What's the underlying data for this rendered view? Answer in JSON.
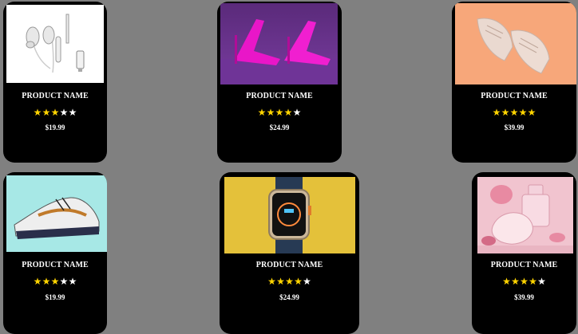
{
  "colors": {
    "page_bg": "#808080",
    "card_bg": "#000000",
    "star_on": "#ffd400",
    "star_off": "#ffffff"
  },
  "products": [
    {
      "name": "PRODUCT NAME",
      "rating": 3,
      "max_rating": 5,
      "price": "$19.99",
      "image": "earphones-image"
    },
    {
      "name": "PRODUCT NAME",
      "rating": 4,
      "max_rating": 5,
      "price": "$24.99",
      "image": "pink-heels-image"
    },
    {
      "name": "PRODUCT NAME",
      "rating": 5,
      "max_rating": 5,
      "price": "$39.99",
      "image": "sneakers-peach-image"
    },
    {
      "name": "PRODUCT NAME",
      "rating": 3,
      "max_rating": 5,
      "price": "$19.99",
      "image": "running-shoe-image"
    },
    {
      "name": "PRODUCT NAME",
      "rating": 4,
      "max_rating": 5,
      "price": "$24.99",
      "image": "smartwatch-image"
    },
    {
      "name": "PRODUCT NAME",
      "rating": 4,
      "max_rating": 5,
      "price": "$39.99",
      "image": "perfume-bottle-image"
    }
  ]
}
